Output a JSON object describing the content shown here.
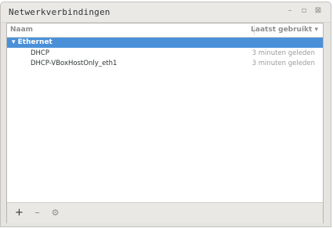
{
  "window": {
    "title": "Netwerkverbindingen",
    "buttons": {
      "minimize": "–",
      "maximize": "▫",
      "close": "⊠"
    }
  },
  "columns": {
    "name": "Naam",
    "last_used": "Laatst gebruikt ▾"
  },
  "groups": [
    {
      "label": "▾ Ethernet",
      "connections": [
        {
          "name": "DHCP",
          "last_used": "3 minuten geleden"
        },
        {
          "name": "DHCP-VBoxHostOnly_eth1",
          "last_used": "3 minuten geleden"
        }
      ]
    }
  ],
  "toolbar": {
    "add": "+",
    "remove": "–",
    "settings": "⚙"
  },
  "colors": {
    "selection": "#4a90d9",
    "muted_text": "#9a9d99"
  }
}
